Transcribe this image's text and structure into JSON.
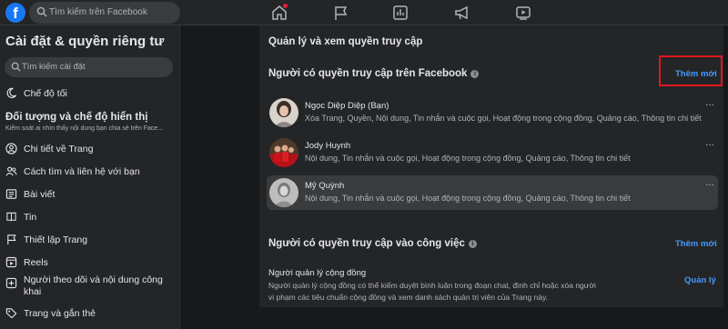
{
  "topbar": {
    "search_placeholder": "Tìm kiếm trên Facebook",
    "logo_letter": "f",
    "nav_icons": [
      "home-icon",
      "flag-icon",
      "insights-icon",
      "megaphone-icon",
      "video-icon"
    ],
    "accent": "#1877f2",
    "notification_color": "#e41e3f"
  },
  "sidebar": {
    "title": "Cài đặt & quyền riêng tư",
    "search_placeholder": "Tìm kiếm cài đặt",
    "dark_mode_label": "Chế độ tối",
    "section_title": "Đối tượng và chế độ hiển thị",
    "section_subtitle": "Kiểm soát ai nhìn thấy nội dung bạn chia sẻ trên Face...",
    "items": [
      {
        "label": "Chi tiết về Trang",
        "icon": "person-circle-icon"
      },
      {
        "label": "Cách tìm và liên hệ với bạn",
        "icon": "people-icon"
      },
      {
        "label": "Bài viết",
        "icon": "post-icon"
      },
      {
        "label": "Tin",
        "icon": "book-icon"
      },
      {
        "label": "Thiết lập Trang",
        "icon": "flag-icon"
      },
      {
        "label": "Reels",
        "icon": "reels-icon"
      },
      {
        "label": "Người theo dõi và nội dung công khai",
        "icon": "plus-square-icon"
      },
      {
        "label": "Trang và gắn thẻ",
        "icon": "tag-icon"
      }
    ]
  },
  "main": {
    "heading": "Quản lý và xem quyền truy cập",
    "facebook_access": {
      "title": "Người có quyền truy cập trên Facebook",
      "add_label": "Thêm mới",
      "people": [
        {
          "name": "Ngọc Diệp Diệp (Bạn)",
          "permissions": "Xóa Trang, Quyền, Nội dung, Tin nhắn và cuộc gọi, Hoạt động trong cộng đồng, Quảng cáo, Thông tin chi tiết"
        },
        {
          "name": "Jody Huynh",
          "permissions": "Nội dung, Tin nhắn và cuộc gọi, Hoạt động trong cộng đồng, Quảng cáo, Thông tin chi tiết"
        },
        {
          "name": "Mỹ Quỳnh",
          "permissions": "Nội dung, Tin nhắn và cuộc gọi, Hoạt động trong cộng đồng, Quảng cáo, Thông tin chi tiết"
        }
      ],
      "more_label": "..."
    },
    "task_access": {
      "title": "Người có quyền truy cập vào công việc",
      "add_label": "Thêm mới",
      "tasks": [
        {
          "title": "Người quản lý cộng đồng",
          "description": "Người quản lý cộng đồng có thể kiểm duyệt bình luận trong đoạn chat, đình chỉ hoặc xóa người vi phạm các tiêu chuẩn cộng đồng và xem danh sách quản trị viên của Trang này.",
          "action_label": "Quản lý"
        }
      ]
    }
  }
}
